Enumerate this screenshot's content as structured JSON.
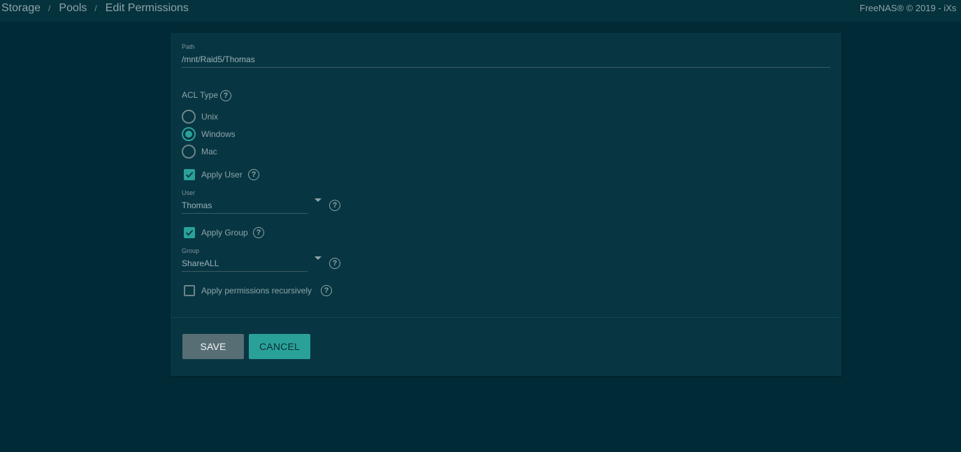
{
  "header": {
    "breadcrumbs": [
      "Storage",
      "Pools",
      "Edit Permissions"
    ],
    "separator": "/",
    "copyright": "FreeNAS® © 2019 - iXs"
  },
  "form": {
    "path": {
      "label": "Path",
      "value": "/mnt/Raid5/Thomas"
    },
    "acl_type": {
      "label": "ACL Type",
      "options": [
        "Unix",
        "Windows",
        "Mac"
      ],
      "selected": "Windows"
    },
    "apply_user": {
      "label": "Apply User",
      "checked": true
    },
    "user": {
      "label": "User",
      "value": "Thomas"
    },
    "apply_group": {
      "label": "Apply Group",
      "checked": true
    },
    "group": {
      "label": "Group",
      "value": "ShareALL"
    },
    "recursive": {
      "label": "Apply permissions recursively",
      "checked": false
    },
    "help_glyph": "?"
  },
  "actions": {
    "save_label": "SAVE",
    "cancel_label": "CANCEL"
  },
  "colors": {
    "background": "#002a35",
    "card": "#073642",
    "accent": "#2aa198",
    "save_button": "#586e75"
  }
}
